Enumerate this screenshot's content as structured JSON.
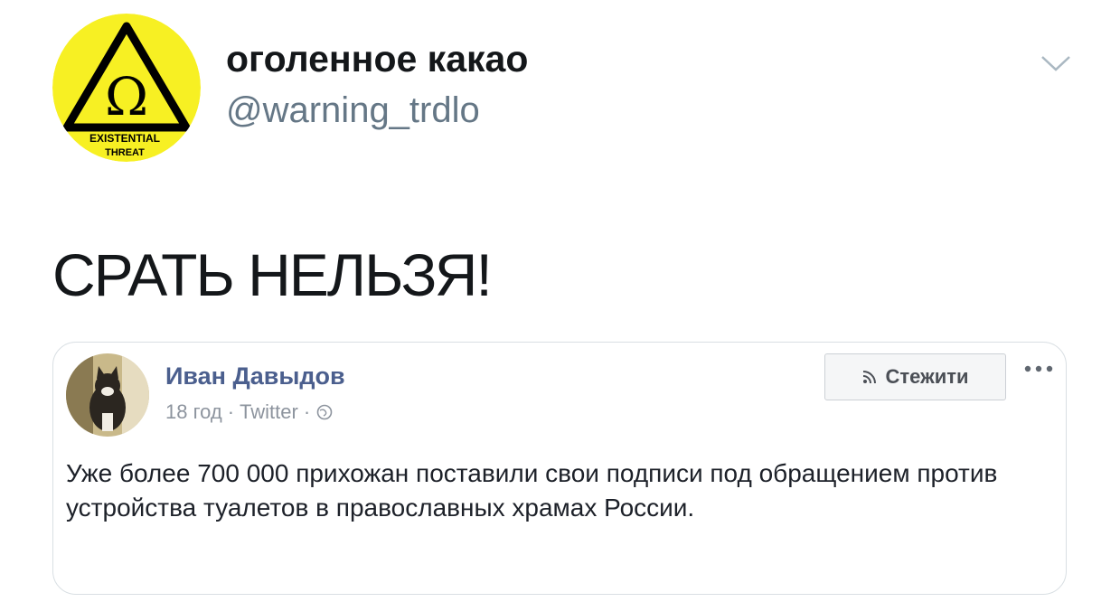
{
  "author": {
    "display_name": "оголенное какао",
    "handle": "@warning_trdlo",
    "avatar": {
      "icon": "omega-warning-sign-icon",
      "symbol": "Ω",
      "caption_line1": "EXISTENTIAL",
      "caption_line2": "THREAT",
      "background_color": "#f7f023",
      "sign_color": "#000000"
    }
  },
  "tweet": {
    "text": "СРАТЬ НЕЛЬЗЯ!"
  },
  "embedded_post": {
    "author_name": "Иван Давыдов",
    "time": "18 год",
    "separator": "·",
    "source": "Twitter",
    "follow_label": "Стежити",
    "body": "Уже более 700 000 прихожан поставили свои подписи под обращением против устройства туалетов в православных храмах России.",
    "colors": {
      "name": "#4b5f8e",
      "meta": "#8d949e"
    }
  }
}
